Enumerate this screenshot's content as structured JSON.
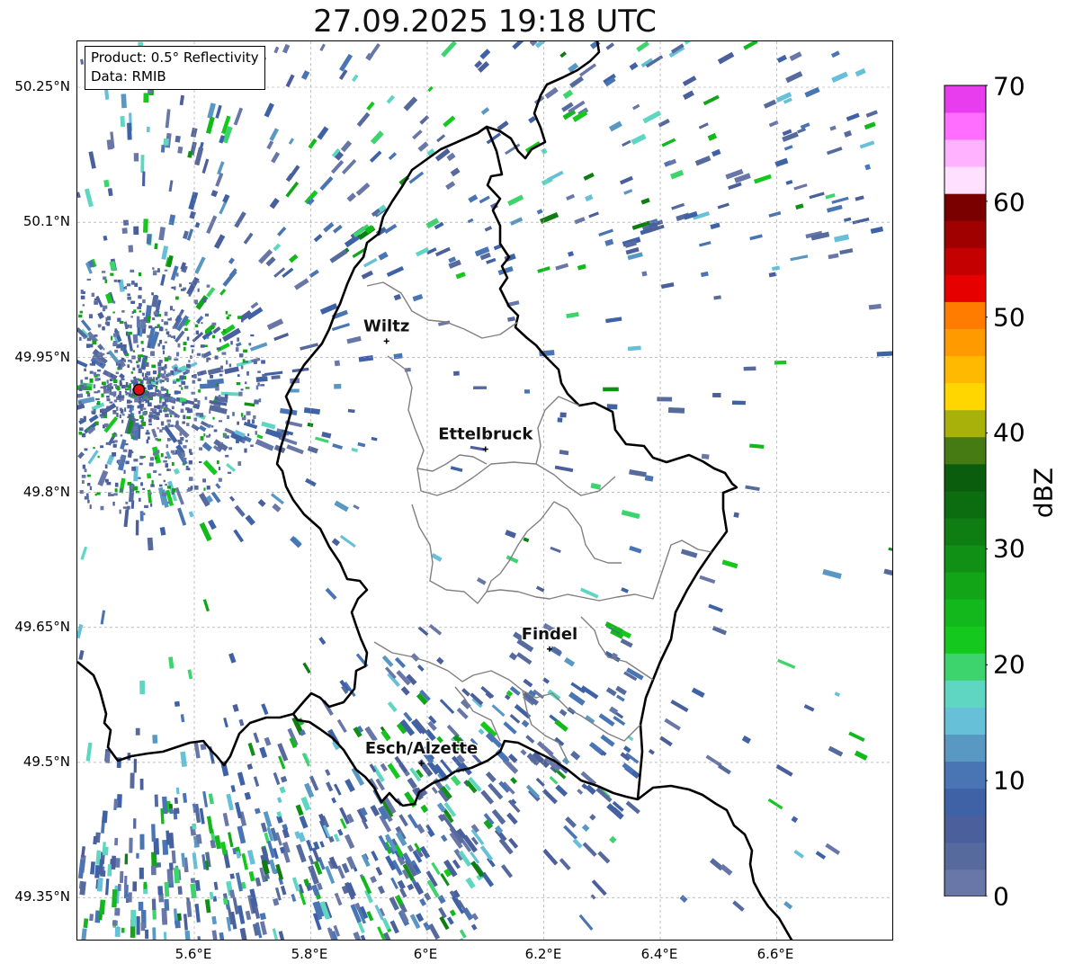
{
  "title": "27.09.2025 19:18 UTC",
  "info_box": {
    "product": "Product: 0.5° Reflectivity",
    "data_source": "Data: RMIB"
  },
  "latitude_labels": [
    "50.25°N",
    "50.1°N",
    "49.95°N",
    "49.8°N",
    "49.65°N",
    "49.5°N",
    "49.35°N"
  ],
  "longitude_labels": [
    "5.6°E",
    "5.8°E",
    "6°E",
    "6.2°E",
    "6.4°E",
    "6.6°E"
  ],
  "cities": [
    {
      "name": "Wiltz",
      "lon": 5.93,
      "lat": 49.968
    },
    {
      "name": "Ettelbruck",
      "lon": 6.1,
      "lat": 49.848
    },
    {
      "name": "Findel",
      "lon": 6.21,
      "lat": 49.626
    },
    {
      "name": "Esch/Alzette",
      "lon": 5.99,
      "lat": 49.499
    }
  ],
  "radar_site": {
    "lon": 5.505,
    "lat": 49.914
  },
  "colorbar": {
    "label": "dBZ",
    "min": 0,
    "max": 70,
    "tick_labels": [
      "0",
      "10",
      "20",
      "30",
      "40",
      "50",
      "60",
      "70"
    ],
    "colors": [
      "#6877a8",
      "#566a9e",
      "#4a5f9c",
      "#3f62a6",
      "#4a75b4",
      "#5a98c4",
      "#66c0d8",
      "#5fd6c2",
      "#3dd46e",
      "#14c81e",
      "#13b81c",
      "#12a518",
      "#109014",
      "#0e7e12",
      "#0b6d0f",
      "#0a5d0c",
      "#467a12",
      "#a8b00a",
      "#ffd600",
      "#ffb900",
      "#ff9a00",
      "#ff7c00",
      "#e60000",
      "#c40000",
      "#a00000",
      "#7a0000",
      "#ffe0ff",
      "#ffb2ff",
      "#ff6eff",
      "#e83cef"
    ]
  },
  "colors": {
    "border_country": "#000000",
    "border_canton": "#808080",
    "radar_marker": "#e01010"
  }
}
